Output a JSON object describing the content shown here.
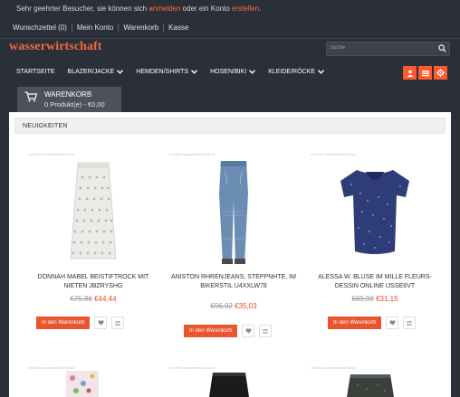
{
  "header": {
    "welcome_prefix": "Sehr geehrter Besucher, sie können sich ",
    "login_link": "anmelden",
    "welcome_middle": " oder ein Konto ",
    "register_link": "erstellen.",
    "quicklinks": [
      "Wunschzettel (0)",
      "Mein Konto",
      "Warenkorb",
      "Kasse"
    ]
  },
  "brand": {
    "logo": "wasserwirtschaft"
  },
  "search": {
    "placeholder": "Suche"
  },
  "nav": {
    "items": [
      "STARTSEITE",
      "BLAZER/JACKE",
      "HEMDEN/SHIRTS",
      "HOSEN/BIKI",
      "KLEIDE/RÖCKE"
    ]
  },
  "cart": {
    "title": "WARENKORB",
    "summary": "0 Produkt(e) - €0,00"
  },
  "section": {
    "title": "NEUIGKEITEN"
  },
  "watermark": "modelle-wasserwirtschaft.de",
  "products": [
    {
      "title": "DONNAH MABEL BEISTIFTROCK MIT NIETEN JBZRYSHG",
      "old_price": "€75,86",
      "new_price": "€44,44",
      "button": "In den Warenkorb"
    },
    {
      "title": "ANISTON RHRENJEANS, STEPPNHTE, IM BIKERSTIL U4XXLW78",
      "old_price": "€96,92",
      "new_price": "€35,03",
      "button": "In den Warenkorb"
    },
    {
      "title": "ALESSA W. BLUSE IM MILLE FLEURS-DESSIN ONLINE IJSSE6VT",
      "old_price": "€69,99",
      "new_price": "€31,15",
      "button": "In den Warenkorb"
    }
  ],
  "colors": {
    "accent": "#e9552f",
    "dark": "#2b3038",
    "price": "#e94a2a"
  }
}
